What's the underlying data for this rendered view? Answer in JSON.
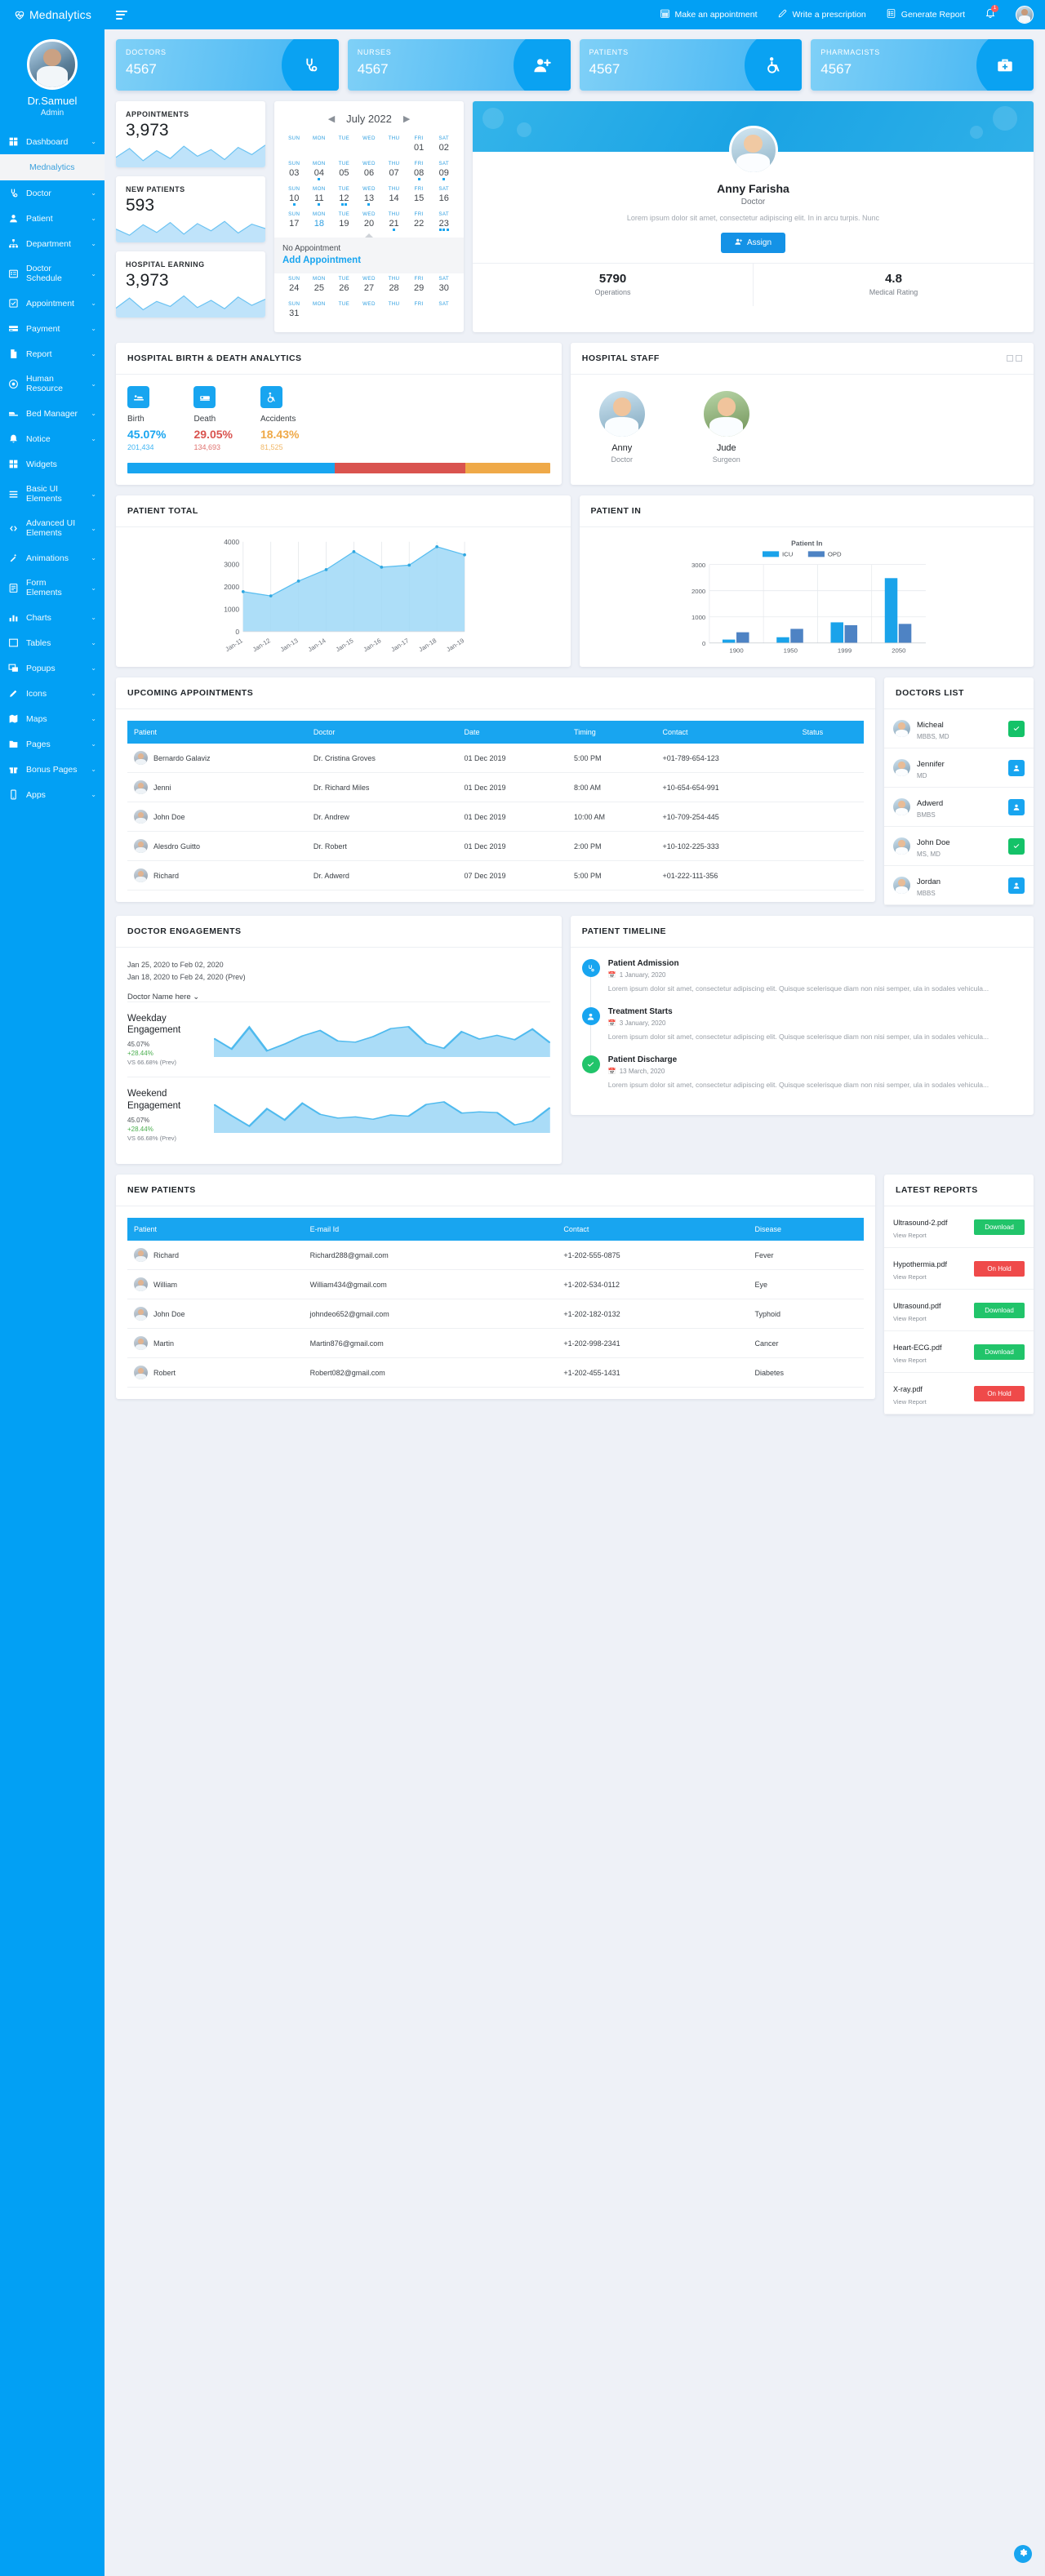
{
  "brand": {
    "name": "Mednalytics",
    "logo_icon": "heartbeat-icon"
  },
  "profile": {
    "name": "Dr.Samuel",
    "role": "Admin"
  },
  "sidebar": {
    "items": [
      {
        "label": "Dashboard",
        "icon": "grid-icon",
        "chevron": "⌄",
        "active": true
      },
      {
        "label": "Doctor",
        "icon": "stethoscope-icon",
        "chevron": "⌄"
      },
      {
        "label": "Patient",
        "icon": "user-icon",
        "chevron": "⌄"
      },
      {
        "label": "Department",
        "icon": "sitemap-icon",
        "chevron": "⌄"
      },
      {
        "label": "Doctor Schedule",
        "icon": "list-icon",
        "chevron": "⌄"
      },
      {
        "label": "Appointment",
        "icon": "check-square-icon",
        "chevron": "⌄"
      },
      {
        "label": "Payment",
        "icon": "card-icon",
        "chevron": "⌄"
      },
      {
        "label": "Report",
        "icon": "document-icon",
        "chevron": "⌄"
      },
      {
        "label": "Human Resource",
        "icon": "badge-icon",
        "chevron": "⌄"
      },
      {
        "label": "Bed Manager",
        "icon": "bed-icon",
        "chevron": "⌄"
      },
      {
        "label": "Notice",
        "icon": "bell-icon",
        "chevron": "⌄"
      },
      {
        "label": "Widgets",
        "icon": "widgets-icon",
        "chevron": ""
      },
      {
        "label": "Basic UI Elements",
        "icon": "layers-icon",
        "chevron": "⌄"
      },
      {
        "label": "Advanced UI Elements",
        "icon": "code-icon",
        "chevron": "⌄"
      },
      {
        "label": "Animations",
        "icon": "magic-icon",
        "chevron": "⌄"
      },
      {
        "label": "Form Elements",
        "icon": "form-icon",
        "chevron": "⌄"
      },
      {
        "label": "Charts",
        "icon": "chart-icon",
        "chevron": "⌄"
      },
      {
        "label": "Tables",
        "icon": "table-icon",
        "chevron": "⌄"
      },
      {
        "label": "Popups",
        "icon": "popup-icon",
        "chevron": "⌄"
      },
      {
        "label": "Icons",
        "icon": "pen-icon",
        "chevron": "⌄"
      },
      {
        "label": "Maps",
        "icon": "map-icon",
        "chevron": "⌄"
      },
      {
        "label": "Pages",
        "icon": "folder-icon",
        "chevron": "⌄"
      },
      {
        "label": "Bonus Pages",
        "icon": "gift-icon",
        "chevron": "⌄"
      },
      {
        "label": "Apps",
        "icon": "mobile-icon",
        "chevron": "⌄"
      }
    ],
    "submenu_label": "Mednalytics"
  },
  "topbar": {
    "actions": [
      {
        "label": "Make an appointment",
        "icon": "calendar-icon"
      },
      {
        "label": "Write a prescription",
        "icon": "pencil-icon"
      },
      {
        "label": "Generate Report",
        "icon": "clipboard-icon"
      }
    ],
    "notification_count": "1"
  },
  "stats": [
    {
      "label": "DOCTORS",
      "value": "4567",
      "icon": "stethoscope-icon"
    },
    {
      "label": "NURSES",
      "value": "4567",
      "icon": "user-plus-icon"
    },
    {
      "label": "PATIENTS",
      "value": "4567",
      "icon": "wheelchair-icon"
    },
    {
      "label": "PHARMACISTS",
      "value": "4567",
      "icon": "medkit-icon"
    }
  ],
  "minis": [
    {
      "title": "APPOINTMENTS",
      "value": "3,973"
    },
    {
      "title": "NEW PATIENTS",
      "value": "593"
    },
    {
      "title": "HOSPITAL EARNING",
      "value": "3,973"
    }
  ],
  "calendar": {
    "month": "July 2022",
    "prev_icon": "caret-left-icon",
    "next_icon": "caret-right-icon",
    "dow": [
      "SUN",
      "MON",
      "TUE",
      "WED",
      "THU",
      "FRI",
      "SAT"
    ],
    "weeks": [
      [
        {
          "d": ""
        },
        {
          "d": ""
        },
        {
          "d": ""
        },
        {
          "d": ""
        },
        {
          "d": ""
        },
        {
          "d": "01"
        },
        {
          "d": "02"
        }
      ],
      [
        {
          "d": "03"
        },
        {
          "d": "04",
          "dots": 1
        },
        {
          "d": "05"
        },
        {
          "d": "06"
        },
        {
          "d": "07"
        },
        {
          "d": "08",
          "dots": 1
        },
        {
          "d": "09",
          "dots": 1
        }
      ],
      [
        {
          "d": "10",
          "dots": 1
        },
        {
          "d": "11",
          "dots": 1
        },
        {
          "d": "12",
          "dots": 2
        },
        {
          "d": "13",
          "dots": 1
        },
        {
          "d": "14"
        },
        {
          "d": "15"
        },
        {
          "d": "16"
        }
      ],
      [
        {
          "d": "17"
        },
        {
          "d": "18",
          "sel": true
        },
        {
          "d": "19"
        },
        {
          "d": "20"
        },
        {
          "d": "21",
          "dots": 1
        },
        {
          "d": "22"
        },
        {
          "d": "23",
          "dots": 3
        }
      ],
      [
        {
          "d": "24"
        },
        {
          "d": "25"
        },
        {
          "d": "26"
        },
        {
          "d": "27"
        },
        {
          "d": "28"
        },
        {
          "d": "29"
        },
        {
          "d": "30"
        }
      ],
      [
        {
          "d": "31"
        },
        {
          "d": ""
        },
        {
          "d": ""
        },
        {
          "d": ""
        },
        {
          "d": ""
        },
        {
          "d": ""
        },
        {
          "d": ""
        }
      ]
    ],
    "no_appointment": "No Appointment",
    "add_appointment": "Add Appointment"
  },
  "doctor_card": {
    "name": "Anny Farisha",
    "role": "Doctor",
    "description": "Lorem ipsum dolor sit amet, consectetur adipiscing elit. In in arcu turpis. Nunc",
    "assign_label": "Assign",
    "assign_icon": "user-plus-icon",
    "stats": [
      {
        "value": "5790",
        "label": "Operations"
      },
      {
        "value": "4.8",
        "label": "Medical Rating"
      }
    ]
  },
  "birth_death": {
    "title": "HOSPITAL BIRTH & DEATH ANALYTICS",
    "metrics": [
      {
        "label": "Birth",
        "percent": "45.07%",
        "count": "201,434",
        "color": "#18a5f0",
        "icon": "bed-baby-icon"
      },
      {
        "label": "Death",
        "percent": "29.05%",
        "count": "134,693",
        "color": "#d9534f",
        "icon": "bed-icon"
      },
      {
        "label": "Accidents",
        "percent": "18.43%",
        "count": "81,525",
        "color": "#efa948",
        "icon": "wheelchair-icon"
      }
    ],
    "bar": [
      {
        "color": "#18a5f0",
        "width": "49%"
      },
      {
        "color": "#d9534f",
        "width": "31%"
      },
      {
        "color": "#efa948",
        "width": "20%"
      }
    ]
  },
  "hospital_staff": {
    "title": "HOSPITAL STAFF",
    "members": [
      {
        "name": "Anny",
        "role": "Doctor"
      },
      {
        "name": "Jude",
        "role": "Surgeon"
      }
    ]
  },
  "chart_data": [
    {
      "type": "area",
      "title": "PATIENT TOTAL",
      "x": [
        "Jan-11",
        "Jan-12",
        "Jan-13",
        "Jan-14",
        "Jan-15",
        "Jan-16",
        "Jan-17",
        "Jan-18",
        "Jan-19"
      ],
      "values": [
        1780,
        1590,
        2250,
        2760,
        3560,
        2870,
        2960,
        3780,
        3420
      ],
      "ylim": [
        0,
        4000
      ],
      "yticks": [
        0,
        1000,
        2000,
        3000,
        4000
      ],
      "xlabel": "",
      "ylabel": "",
      "grid": true,
      "legend": "none"
    },
    {
      "type": "bar",
      "title": "PATIENT IN",
      "chart_label": "Patient In",
      "categories": [
        "1900",
        "1950",
        "1999",
        "2050"
      ],
      "series": [
        {
          "name": "ICU",
          "color": "#1aa3ea",
          "values": [
            130,
            220,
            790,
            2480
          ]
        },
        {
          "name": "OPD",
          "color": "#4e83c4",
          "values": [
            410,
            540,
            680,
            730
          ]
        }
      ],
      "ylim": [
        0,
        3000
      ],
      "yticks": [
        0,
        1000,
        2000,
        3000
      ],
      "legend": "top",
      "grid": true
    },
    {
      "type": "line",
      "title": "APPOINTMENTS",
      "values": [
        30,
        62,
        18,
        54,
        26,
        70,
        34,
        58,
        22,
        66,
        40,
        74
      ],
      "ylim": [
        0,
        100
      ]
    },
    {
      "type": "line",
      "title": "NEW PATIENTS",
      "values": [
        42,
        20,
        58,
        30,
        66,
        24,
        62,
        36,
        70,
        28,
        60,
        44
      ],
      "ylim": [
        0,
        100
      ]
    },
    {
      "type": "line",
      "title": "HOSPITAL EARNING",
      "values": [
        28,
        64,
        22,
        52,
        34,
        72,
        30,
        56,
        26,
        68,
        38,
        60
      ],
      "ylim": [
        0,
        100
      ]
    },
    {
      "type": "area",
      "title": "Weekday Engagement",
      "values": [
        52,
        18,
        88,
        12,
        34,
        60,
        78,
        44,
        40,
        58,
        84,
        90,
        36,
        20,
        74,
        50,
        62,
        48,
        82,
        38
      ],
      "ylim": [
        0,
        100
      ]
    },
    {
      "type": "area",
      "title": "Weekend Engagement",
      "values": [
        84,
        48,
        14,
        70,
        34,
        88,
        52,
        40,
        44,
        36,
        50,
        46,
        84,
        92,
        56,
        60,
        58,
        18,
        30,
        74
      ],
      "ylim": [
        0,
        100
      ]
    }
  ],
  "upcoming": {
    "title": "UPCOMING APPOINTMENTS",
    "columns": [
      "Patient",
      "Doctor",
      "Date",
      "Timing",
      "Contact",
      "Status"
    ],
    "rows": [
      {
        "patient": "Bernardo Galaviz",
        "doctor": "Dr. Cristina Groves",
        "date": "01 Dec 2019",
        "timing": "5:00 PM",
        "contact": "+01-789-654-123",
        "status": "on"
      },
      {
        "patient": "Jenni",
        "doctor": "Dr. Richard Miles",
        "date": "01 Dec 2019",
        "timing": "8:00 AM",
        "contact": "+10-654-654-991",
        "status": "on"
      },
      {
        "patient": "John Doe",
        "doctor": "Dr. Andrew",
        "date": "01 Dec 2019",
        "timing": "10:00 AM",
        "contact": "+10-709-254-445",
        "status": "off"
      },
      {
        "patient": "Alesdro Guitto",
        "doctor": "Dr. Robert",
        "date": "01 Dec 2019",
        "timing": "2:00 PM",
        "contact": "+10-102-225-333",
        "status": "on"
      },
      {
        "patient": "Richard",
        "doctor": "Dr. Adwerd",
        "date": "07 Dec 2019",
        "timing": "5:00 PM",
        "contact": "+01-222-111-356",
        "status": "off"
      }
    ]
  },
  "doctors_list": {
    "title": "DOCTORS LIST",
    "rows": [
      {
        "name": "Micheal",
        "degree": "MBBS, MD",
        "action": "green",
        "action_icon": "check-icon"
      },
      {
        "name": "Jennifer",
        "degree": "MD",
        "action": "blue",
        "action_icon": "user-icon"
      },
      {
        "name": "Adwerd",
        "degree": "BMBS",
        "action": "blue",
        "action_icon": "user-icon"
      },
      {
        "name": "John Doe",
        "degree": "MS, MD",
        "action": "green",
        "action_icon": "check-icon"
      },
      {
        "name": "Jordan",
        "degree": "MBBS",
        "action": "blue",
        "action_icon": "user-icon"
      }
    ]
  },
  "engagements": {
    "title": "DOCTOR ENGAGEMENTS",
    "date_current": "Jan 25, 2020 to Feb 02, 2020",
    "date_prev": "Jan 18, 2020 to Feb 24, 2020 (Prev)",
    "selector": "Doctor Name here",
    "selector_icon": "chevron-down-icon",
    "blocks": [
      {
        "title": "Weekday Engagement",
        "value": "45.07%",
        "change": "+28.44%",
        "prev": "VS 66.68% (Prev)"
      },
      {
        "title": "Weekend Engagement",
        "value": "45.07%",
        "change": "+28.44%",
        "prev": "VS 66.68% (Prev)"
      }
    ]
  },
  "timeline": {
    "title": "PATIENT TIMELINE",
    "items": [
      {
        "title": "Patient Admission",
        "date": "1 January, 2020",
        "color": "#18a5f0",
        "icon": "stethoscope-icon",
        "body": "Lorem ipsum dolor sit amet, consectetur adipiscing elit. Quisque scelerisque diam non nisi semper, ula in sodales vehicula..."
      },
      {
        "title": "Treatment Starts",
        "date": "3 January, 2020",
        "color": "#18a5f0",
        "icon": "user-icon",
        "body": "Lorem ipsum dolor sit amet, consectetur adipiscing elit. Quisque scelerisque diam non nisi semper, ula in sodales vehicula..."
      },
      {
        "title": "Patient Discharge",
        "date": "13 March, 2020",
        "color": "#21c46a",
        "icon": "check-icon",
        "body": "Lorem ipsum dolor sit amet, consectetur adipiscing elit. Quisque scelerisque diam non nisi semper, ula in sodales vehicula..."
      }
    ]
  },
  "new_patients": {
    "title": "NEW PATIENTS",
    "columns": [
      "Patient",
      "E-mail Id",
      "Contact",
      "Disease"
    ],
    "rows": [
      {
        "patient": "Richard",
        "email": "Richard288@gmail.com",
        "contact": "+1-202-555-0875",
        "disease": "Fever"
      },
      {
        "patient": "William",
        "email": "William434@gmail.com",
        "contact": "+1-202-534-0112",
        "disease": "Eye"
      },
      {
        "patient": "John Doe",
        "email": "johndeo652@gmail.com",
        "contact": "+1-202-182-0132",
        "disease": "Typhoid"
      },
      {
        "patient": "Martin",
        "email": "Martin876@gmail.com",
        "contact": "+1-202-998-2341",
        "disease": "Cancer"
      },
      {
        "patient": "Robert",
        "email": "Robert082@gmail.com",
        "contact": "+1-202-455-1431",
        "disease": "Diabetes"
      }
    ]
  },
  "latest_reports": {
    "title": "LATEST REPORTS",
    "view_label": "View Report",
    "rows": [
      {
        "file": "Ultrasound-2.pdf",
        "action": "Download",
        "kind": "dl"
      },
      {
        "file": "Hypothermia.pdf",
        "action": "On Hold",
        "kind": "hold"
      },
      {
        "file": "Ultrasound.pdf",
        "action": "Download",
        "kind": "dl"
      },
      {
        "file": "Heart-ECG.pdf",
        "action": "Download",
        "kind": "dl"
      },
      {
        "file": "X-ray.pdf",
        "action": "On Hold",
        "kind": "hold"
      }
    ]
  },
  "fab": {
    "icon": "settings-icon"
  }
}
